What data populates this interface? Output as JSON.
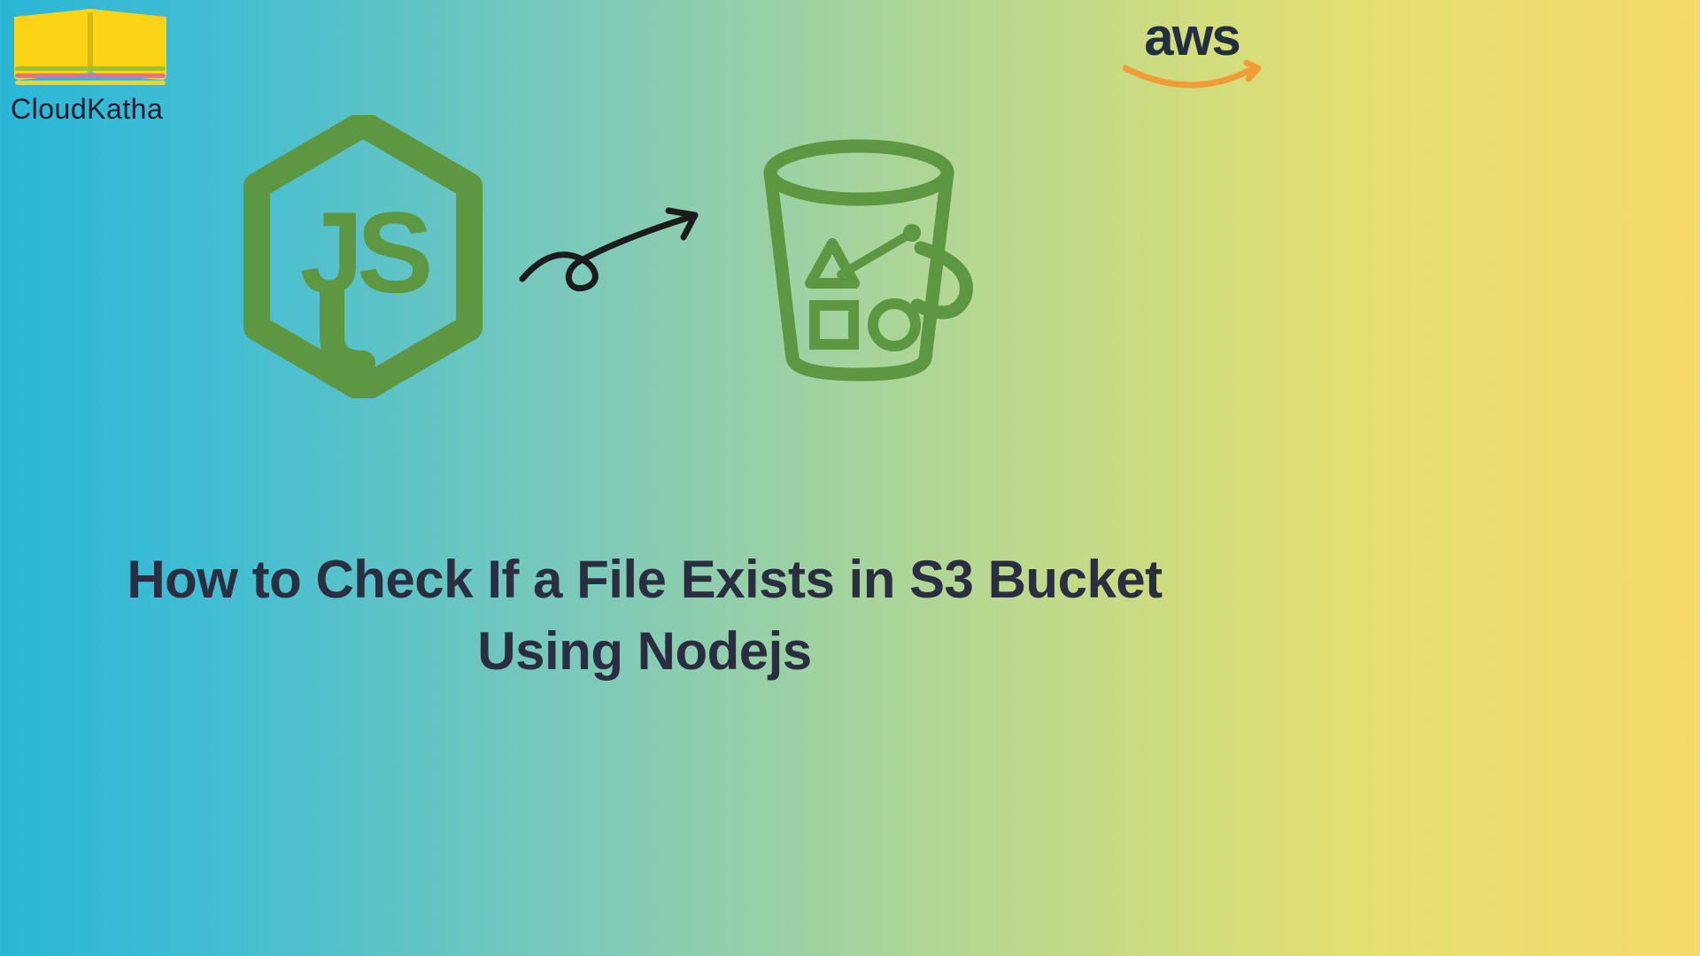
{
  "logo": {
    "cloudkatha_name": "CloudKatha"
  },
  "aws": {
    "text": "aws"
  },
  "title": "How to Check If a File Exists in S3 Bucket Using Nodejs",
  "icons": {
    "nodejs": "nodejs-icon",
    "arrow": "squiggle-arrow-icon",
    "bucket": "s3-bucket-icon",
    "aws_smile": "aws-smile-icon",
    "cloudkatha": "cloudkatha-book-icon"
  },
  "colors": {
    "nodejs_green": "#5d9741",
    "bucket_green": "#5d9741",
    "arrow_black": "#1b1b1b",
    "title_dark": "#2a2e40",
    "aws_dark": "#232f3e",
    "aws_orange": "#f29c38"
  }
}
